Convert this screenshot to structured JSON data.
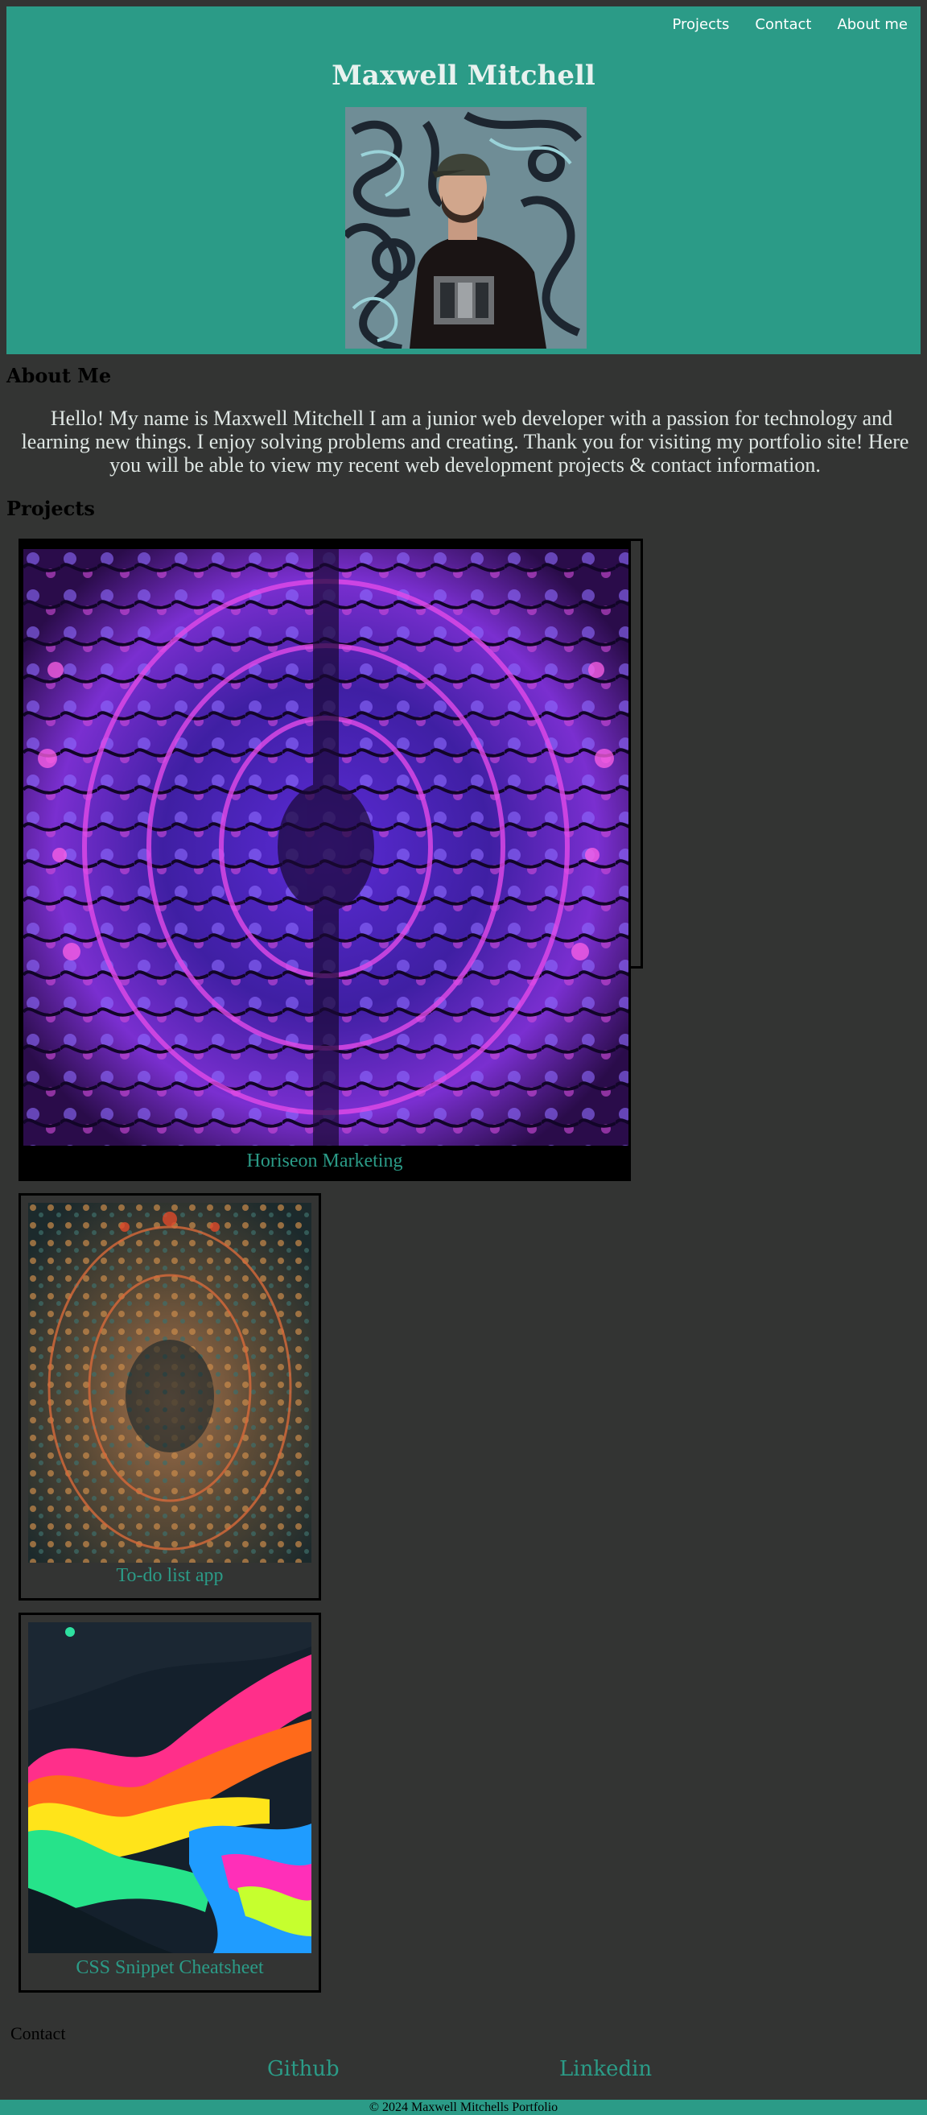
{
  "header": {
    "title": "Maxwell Mitchell",
    "nav": [
      "Projects",
      "Contact",
      "About me"
    ],
    "avatar_icon": "person-portrait-icon"
  },
  "about": {
    "heading": "About Me",
    "text": "Hello! My name is Maxwell Mitchell I am a junior web developer with a passion for technology and learning new things. I enjoy solving problems and creating. Thank you for visiting my portfolio site! Here you will be able to view my recent web development projects & contact information."
  },
  "projects": {
    "heading": "Projects",
    "items": [
      {
        "title": "Horiseon Marketing"
      },
      {
        "title": "To-do list app"
      },
      {
        "title": "CSS Snippet Cheatsheet"
      }
    ]
  },
  "contact": {
    "label": "Contact",
    "links": [
      "Github",
      "Linkedin"
    ]
  },
  "footer": {
    "text": "© 2024 Maxwell Mitchells Portfolio"
  },
  "colors": {
    "accent": "#2b9b87",
    "background": "#333433"
  }
}
